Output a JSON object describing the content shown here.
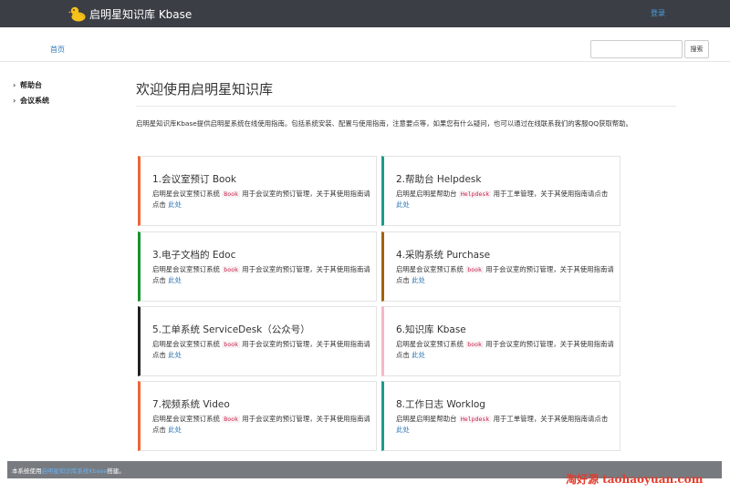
{
  "header": {
    "brand": "启明星知识库 Kbase",
    "login": "登录"
  },
  "nav": {
    "home": "首页",
    "search_placeholder": "",
    "search_button": "搜索"
  },
  "sidebar": {
    "items": [
      {
        "label": "帮助台"
      },
      {
        "label": "会议系统"
      }
    ]
  },
  "main": {
    "title": "欢迎使用启明星知识库",
    "intro": "启明星知识库Kbase提供启明星系统在线使用指南。包括系统安装、配置与使用指南，注意要点等，如果您有什么疑问，也可以通过在线联系我们的客服QQ获取帮助。",
    "cards": [
      {
        "title": "1.会议室预订 Book",
        "desc_prefix": "启明星会议室预订系统",
        "code": "Book",
        "desc_suffix": "用于会议室的预订管理，关于其使用指南请点击",
        "link": "此处",
        "color": "#ec6535"
      },
      {
        "title": "2.帮助台 Helpdesk",
        "desc_prefix": "启明星启明星帮助台",
        "code": "Helpdesk",
        "desc_suffix": "用于工单管理，关于其使用指南请点击",
        "link": "此处",
        "color": "#1b9b8d"
      },
      {
        "title": "3.电子文档的 Edoc",
        "desc_prefix": "启明星会议室预订系统",
        "code": "book",
        "desc_suffix": "用于会议室的预订管理，关于其使用指南请点击",
        "link": "此处",
        "color": "#16922f"
      },
      {
        "title": "4.采购系统 Purchase",
        "desc_prefix": "启明星会议室预订系统",
        "code": "book",
        "desc_suffix": "用于会议室的预订管理，关于其使用指南请点击",
        "link": "此处",
        "color": "#a0640a"
      },
      {
        "title": "5.工单系统 ServiceDesk（公众号）",
        "desc_prefix": "启明星会议室预订系统",
        "code": "book",
        "desc_suffix": "用于会议室的预订管理，关于其使用指南请点击",
        "link": "此处",
        "color": "#222222"
      },
      {
        "title": "6.知识库 Kbase",
        "desc_prefix": "启明星会议室预订系统",
        "code": "book",
        "desc_suffix": "用于会议室的预订管理，关于其使用指南请点击",
        "link": "此处",
        "color": "#f5b8c6"
      },
      {
        "title": "7.视频系统 Video",
        "desc_prefix": "启明星会议室预订系统",
        "code": "Book",
        "desc_suffix": "用于会议室的预订管理，关于其使用指南请点击",
        "link": "此处",
        "color": "#ec6535"
      },
      {
        "title": "8.工作日志 Worklog",
        "desc_prefix": "启明星启明星帮助台",
        "code": "Helpdesk",
        "desc_suffix": "用于工单管理，关于其使用指南请点击",
        "link": "此处",
        "color": "#1b9b8d"
      }
    ]
  },
  "footer": {
    "prefix": "本系统使用",
    "link": "启明星知识库系统Kbase",
    "suffix": "搭建。"
  },
  "watermark": "淘好源 taohaoyuan.com"
}
